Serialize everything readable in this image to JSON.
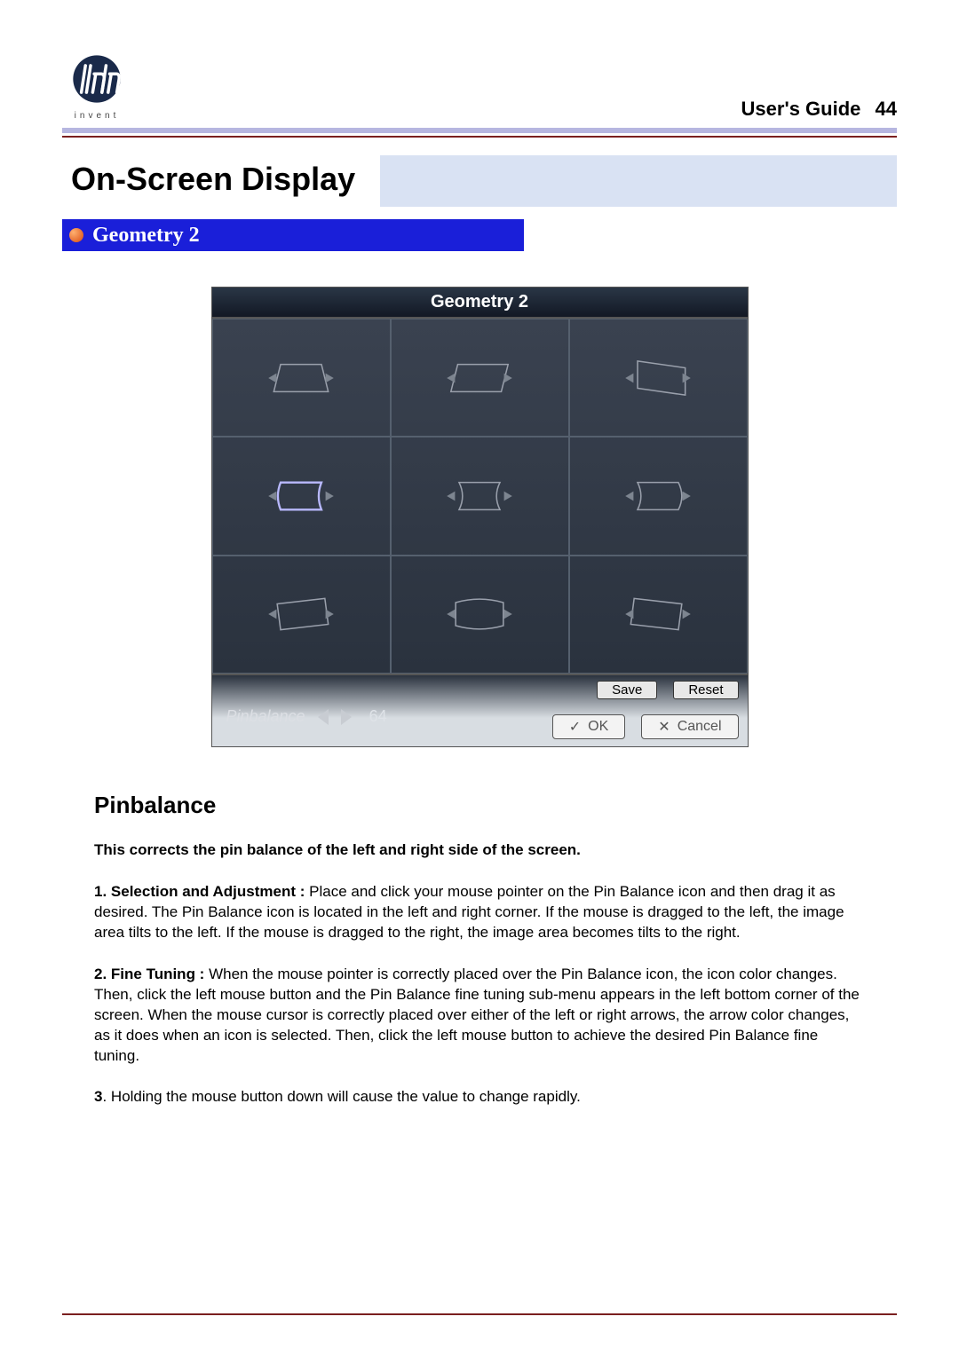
{
  "header": {
    "logo_tag": "invent",
    "guide_label": "User's Guide",
    "page_number": "44"
  },
  "title": "On-Screen Display",
  "subsection": "Geometry 2",
  "osd": {
    "title": "Geometry 2",
    "param_label": "Pinbalance",
    "param_value": "64",
    "btn_save": "Save",
    "btn_reset": "Reset",
    "btn_ok": "OK",
    "btn_cancel": "Cancel"
  },
  "section_heading": "Pinbalance",
  "lead": "This corrects the pin balance of the left and right side of the screen.",
  "p1_label": "1. Selection and Adjustment :",
  "p1_body": " Place and click your mouse pointer on the Pin Balance icon and then drag it as desired. The Pin Balance icon is located in the left and right corner. If the mouse is dragged to the left, the image area tilts to the left. If the mouse is dragged to the right, the image area becomes tilts to the right.",
  "p2_label": "2. Fine Tuning :",
  "p2_body": " When the mouse pointer is correctly placed over the Pin Balance icon, the icon color changes. Then, click the left mouse button and the Pin Balance fine tuning sub-menu appears in the left bottom corner of the screen. When the mouse cursor is correctly placed over either of the left or right arrows, the arrow color changes, as it does when an icon is selected. Then, click the left mouse button to achieve the desired Pin Balance fine tuning.",
  "p3_label": "3",
  "p3_body": ". Holding the mouse button down will cause the value to change rapidly."
}
